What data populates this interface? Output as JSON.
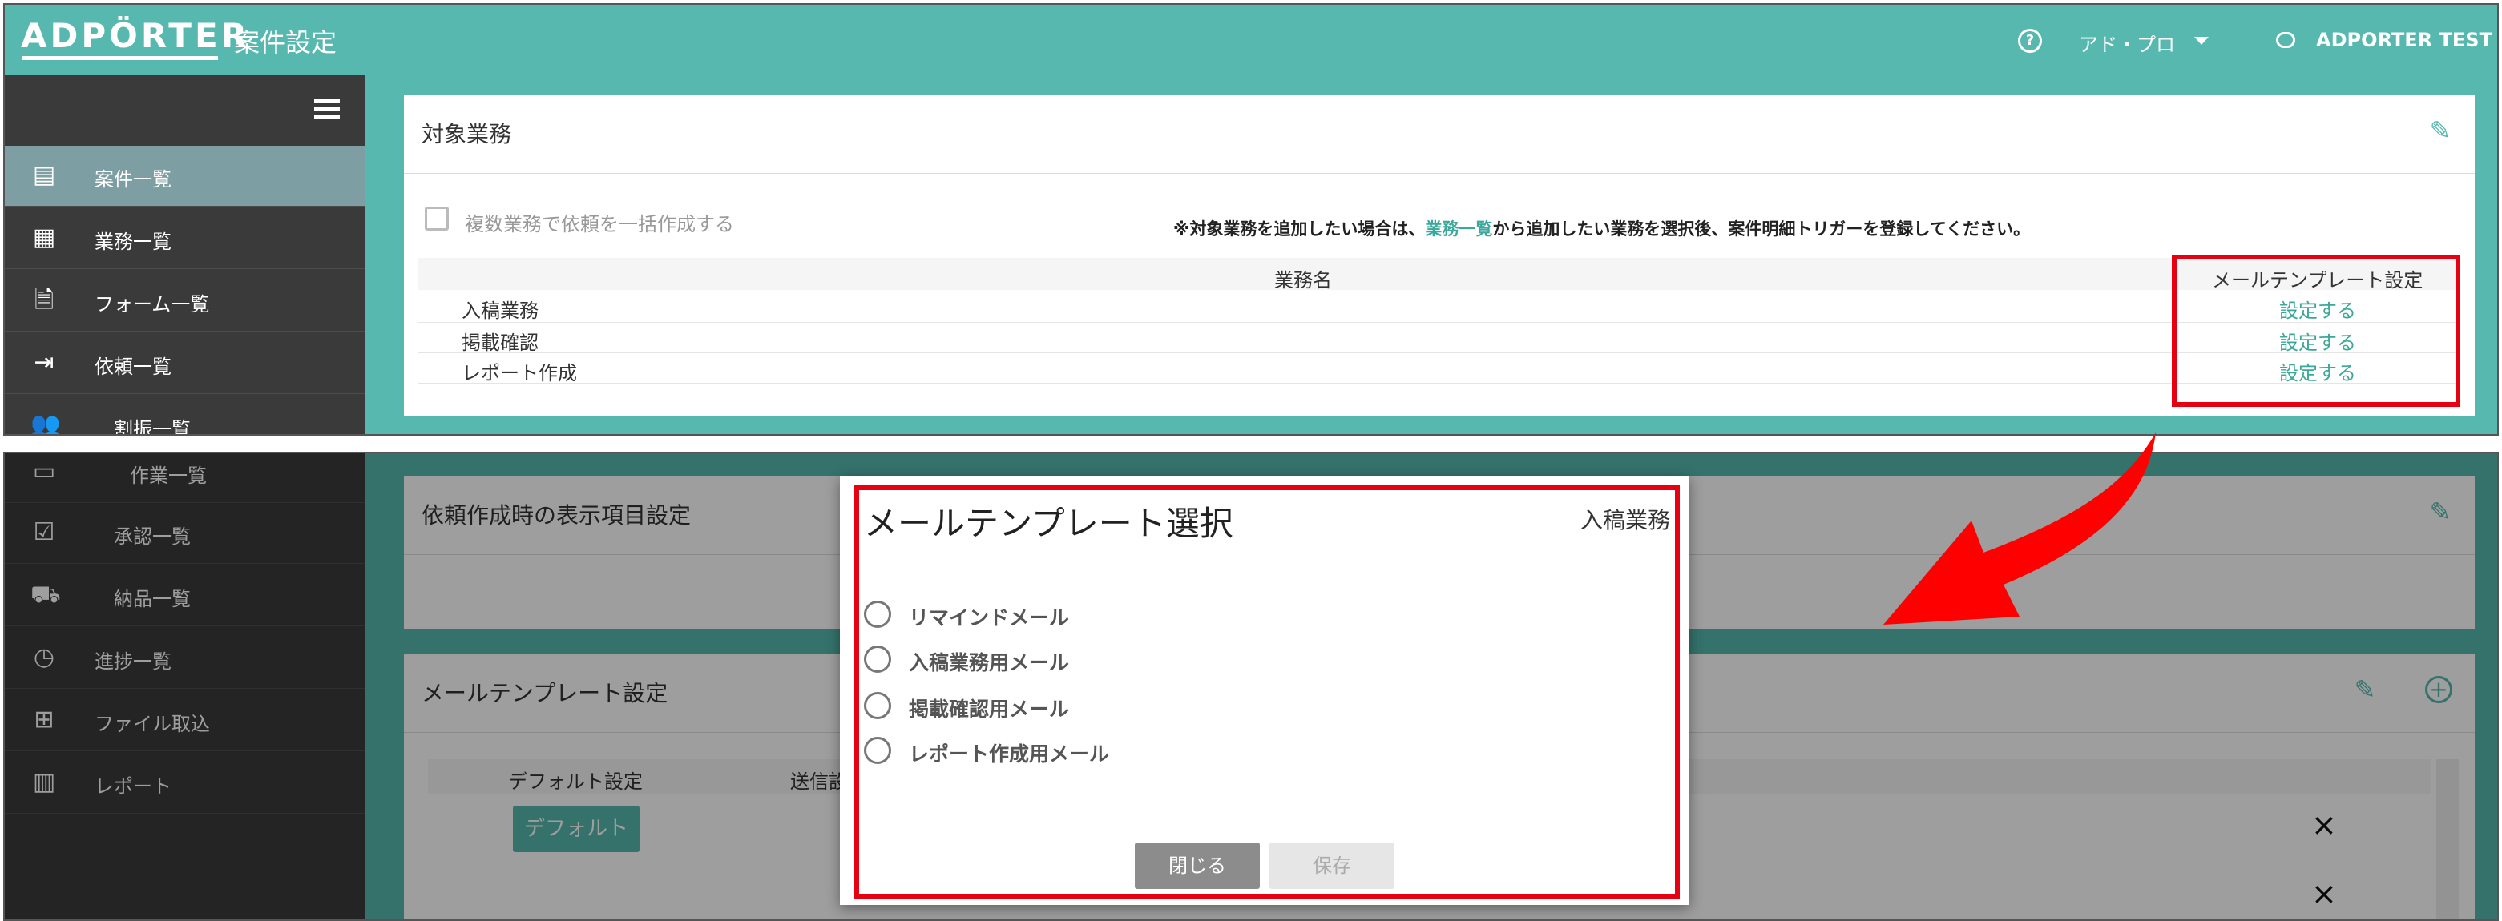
{
  "header": {
    "logo": "ADPÖRTER",
    "title": "案件設定",
    "help_icon": "?",
    "user_menu": "アド・プロ",
    "account_name": "ADPORTER TEST"
  },
  "sidebar": {
    "items": [
      {
        "label": "案件一覧",
        "icon": "document-icon"
      },
      {
        "label": "業務一覧",
        "icon": "building-icon"
      },
      {
        "label": "フォーム一覧",
        "icon": "form-file-icon"
      },
      {
        "label": "依頼一覧",
        "icon": "login-icon"
      },
      {
        "label": "割振一覧",
        "icon": "people-icon"
      },
      {
        "label": "作業一覧",
        "icon": "monitor-icon"
      },
      {
        "label": "承認一覧",
        "icon": "approval-icon"
      },
      {
        "label": "納品一覧",
        "icon": "truck-icon"
      },
      {
        "label": "進捗一覧",
        "icon": "clock-icon"
      },
      {
        "label": "ファイル取込",
        "icon": "table-add-icon"
      },
      {
        "label": "レポート",
        "icon": "bar-chart-icon"
      }
    ]
  },
  "target_tasks": {
    "title": "対象業務",
    "bulk_checkbox_label": "複数業務で依頼を一括作成する",
    "notice_prefix": "※対象業務を追加したい場合は、",
    "notice_link": "業務一覧",
    "notice_suffix": "から追加したい業務を選択後、案件明細トリガーを登録してください。",
    "columns": [
      "業務名",
      "メールテンプレート設定"
    ],
    "rows": [
      {
        "name": "入稿業務",
        "action": "設定する"
      },
      {
        "name": "掲載確認",
        "action": "設定する"
      },
      {
        "name": "レポート作成",
        "action": "設定する"
      }
    ]
  },
  "request_display": {
    "title": "依頼作成時の表示項目設定"
  },
  "mail_template_settings": {
    "title": "メールテンプレート設定",
    "columns": [
      "デフォルト設定",
      "送信設"
    ],
    "default_button": "デフォルト",
    "delete_icon": "×"
  },
  "modal": {
    "title": "メールテンプレート選択",
    "subtitle": "入稿業務",
    "options": [
      "リマインドメール",
      "入稿業務用メール",
      "掲載確認用メール",
      "レポート作成用メール"
    ],
    "close_label": "閉じる",
    "save_label": "保存"
  },
  "colors": {
    "accent": "#56b8ae",
    "sidebar": "#3a3a3a",
    "highlight": "#e60012"
  }
}
